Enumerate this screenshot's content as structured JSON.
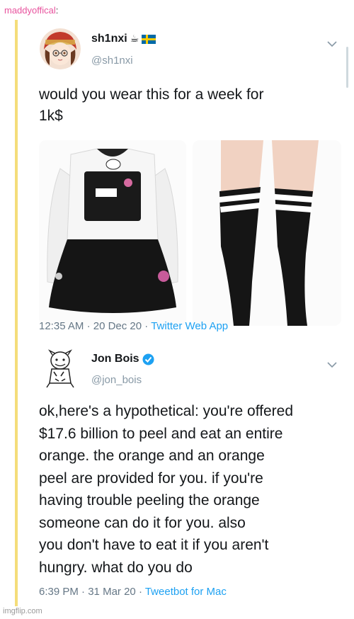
{
  "reblog": {
    "username": "maddyoffical",
    "colon": ":"
  },
  "tweet1": {
    "display_name": "sh1nxi",
    "handle": "@sh1nxi",
    "emoji": "☕",
    "text_lines": [
      "would you wear this for a week for",
      "1k$"
    ],
    "time": "12:35 AM",
    "date": "20 Dec 20",
    "app": "Twitter Web App",
    "images": [
      "dress-image",
      "thigh-high-socks-image"
    ]
  },
  "tweet2": {
    "display_name": "Jon Bois",
    "handle": "@jon_bois",
    "verified": true,
    "text_lines": [
      "ok,here's a hypothetical: you're offered",
      "$17.6 billion to peel and eat an entire",
      "orange. the orange and an orange",
      "peel are provided for you. if you're",
      "having trouble peeling the orange",
      "someone can do it for you. also",
      "you don't have to eat it if you aren't",
      "hungry. what do you do"
    ],
    "time": "6:39 PM",
    "date": "31 Mar 20",
    "app": "Tweetbot for Mac"
  },
  "watermark": "imgflip.com",
  "colors": {
    "link": "#1da1f2",
    "meta": "#657786",
    "quote_bar": "#f4dd7a",
    "reblog_user": "#e8539e"
  }
}
